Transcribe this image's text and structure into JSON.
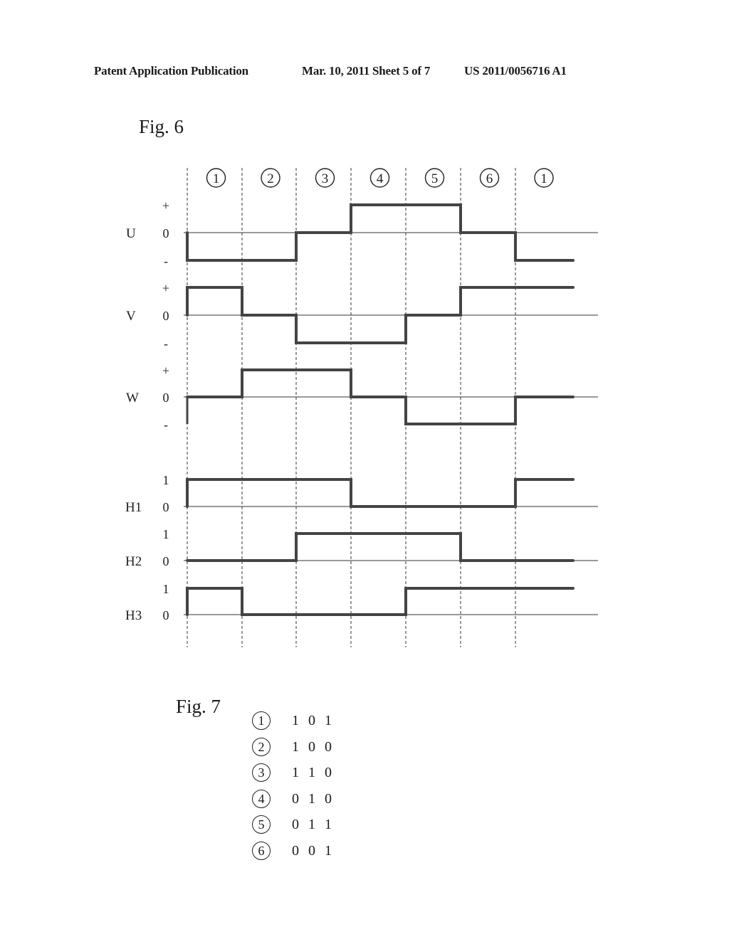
{
  "header": {
    "left": "Patent Application Publication",
    "middle": "Mar. 10, 2011  Sheet 5 of 7",
    "right": "US 2011/0056716 A1"
  },
  "fig6": {
    "label": "Fig. 6",
    "chart_data": {
      "type": "line",
      "title": "Fig. 6",
      "step_type": "step",
      "intervals": [
        "1",
        "2",
        "3",
        "4",
        "5",
        "6",
        "1"
      ],
      "signals": [
        {
          "name": "U",
          "levels": [
            "+",
            "0",
            "-"
          ],
          "values": [
            -1,
            -1,
            0,
            1,
            1,
            0,
            -1
          ]
        },
        {
          "name": "V",
          "levels": [
            "+",
            "0",
            "-"
          ],
          "values": [
            1,
            0,
            -1,
            -1,
            0,
            1,
            1
          ]
        },
        {
          "name": "W",
          "levels": [
            "+",
            "0",
            "-"
          ],
          "values": [
            0,
            1,
            1,
            0,
            -1,
            -1,
            0
          ]
        },
        {
          "name": "H1",
          "levels": [
            "1",
            "0"
          ],
          "values": [
            1,
            1,
            1,
            0,
            0,
            0,
            1
          ]
        },
        {
          "name": "H2",
          "levels": [
            "1",
            "0"
          ],
          "values": [
            0,
            0,
            1,
            1,
            1,
            0,
            0
          ]
        },
        {
          "name": "H3",
          "levels": [
            "1",
            "0"
          ],
          "values": [
            1,
            0,
            0,
            0,
            1,
            1,
            1
          ]
        }
      ],
      "xlabel": "",
      "ylabel": "",
      "grid": "vertical dashed lines at interval boundaries"
    }
  },
  "fig7": {
    "label": "Fig. 7",
    "rows": [
      {
        "state": "1",
        "bits": [
          "1",
          "0",
          "1"
        ]
      },
      {
        "state": "2",
        "bits": [
          "1",
          "0",
          "0"
        ]
      },
      {
        "state": "3",
        "bits": [
          "1",
          "1",
          "0"
        ]
      },
      {
        "state": "4",
        "bits": [
          "0",
          "1",
          "0"
        ]
      },
      {
        "state": "5",
        "bits": [
          "0",
          "1",
          "1"
        ]
      },
      {
        "state": "6",
        "bits": [
          "0",
          "0",
          "1"
        ]
      }
    ]
  }
}
